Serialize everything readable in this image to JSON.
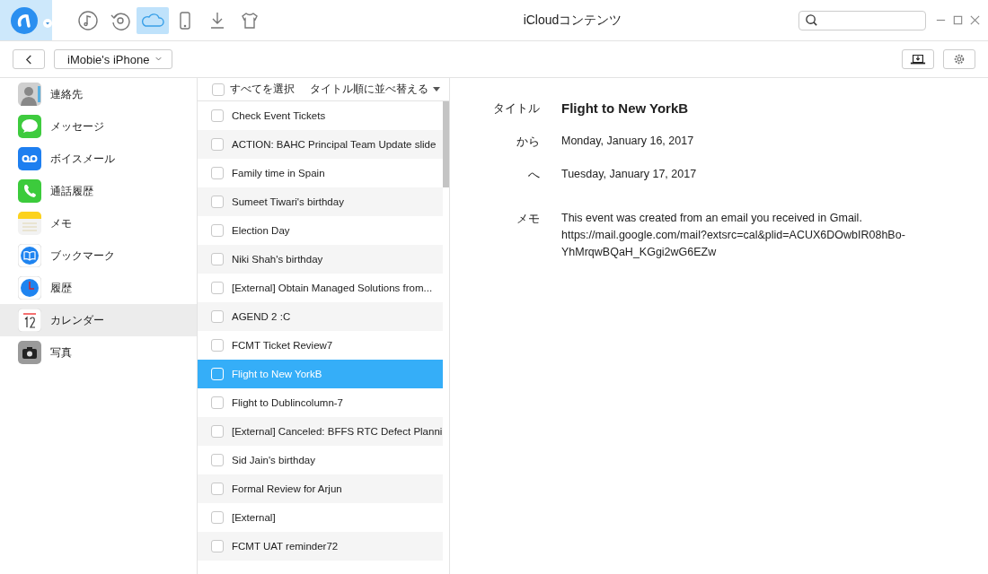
{
  "window": {
    "title": "iCloudコンテンツ"
  },
  "toolbar": [
    {
      "selected": false
    },
    {
      "selected": false
    },
    {
      "selected": true
    },
    {
      "selected": false
    },
    {
      "selected": false
    },
    {
      "selected": false
    }
  ],
  "device": {
    "name": "iMobie's iPhone"
  },
  "sidebar": {
    "items": [
      {
        "label": "連絡先",
        "selected": false
      },
      {
        "label": "メッセージ",
        "selected": false
      },
      {
        "label": "ボイスメール",
        "selected": false
      },
      {
        "label": "通話履歴",
        "selected": false
      },
      {
        "label": "メモ",
        "selected": false
      },
      {
        "label": "ブックマーク",
        "selected": false
      },
      {
        "label": "履歴",
        "selected": false
      },
      {
        "label": "カレンダー",
        "selected": true
      },
      {
        "label": "写真",
        "selected": false
      }
    ]
  },
  "list": {
    "select_all": {
      "label": "すべてを選択",
      "checked": false
    },
    "sort": "タイトル順に並べ替える",
    "rows": [
      {
        "title": "Check Event Tickets",
        "checked": false,
        "selected": false
      },
      {
        "title": "ACTION: BAHC Principal Team Update slide",
        "checked": false,
        "selected": false
      },
      {
        "title": "Family time in Spain",
        "checked": false,
        "selected": false
      },
      {
        "title": "Sumeet Tiwari's birthday",
        "checked": false,
        "selected": false
      },
      {
        "title": "Election Day",
        "checked": false,
        "selected": false
      },
      {
        "title": "Niki Shah's birthday",
        "checked": false,
        "selected": false
      },
      {
        "title": "[External] Obtain Managed Solutions from...",
        "checked": false,
        "selected": false
      },
      {
        "title": "AGEND 2 :C",
        "checked": false,
        "selected": false
      },
      {
        "title": "FCMT Ticket Review7",
        "checked": false,
        "selected": false
      },
      {
        "title": "Flight to New YorkB",
        "checked": false,
        "selected": true
      },
      {
        "title": "Flight to Dublincolumn-7",
        "checked": false,
        "selected": false
      },
      {
        "title": "[External] Canceled: BFFS RTC Defect Planni",
        "checked": false,
        "selected": false
      },
      {
        "title": "Sid Jain's birthday",
        "checked": false,
        "selected": false
      },
      {
        "title": "Formal Review for Arjun",
        "checked": false,
        "selected": false
      },
      {
        "title": "[External]",
        "checked": false,
        "selected": false
      },
      {
        "title": "FCMT UAT reminder72",
        "checked": false,
        "selected": false
      }
    ]
  },
  "detail": {
    "fields": [
      {
        "label": "タイトル",
        "value": "Flight to New YorkB",
        "kind": "title"
      },
      {
        "label": "から",
        "value": "Monday, January 16, 2017",
        "kind": "text"
      },
      {
        "label": "へ",
        "value": "Tuesday, January 17, 2017",
        "kind": "text"
      },
      {
        "label": "メモ",
        "value": "This event was created from an email you received in Gmail. https://mail.google.com/mail?extsrc=cal&plid=ACUX6DOwbIR08hBo-YhMrqwBQaH_KGgi2wG6EZw",
        "kind": "note"
      }
    ]
  }
}
